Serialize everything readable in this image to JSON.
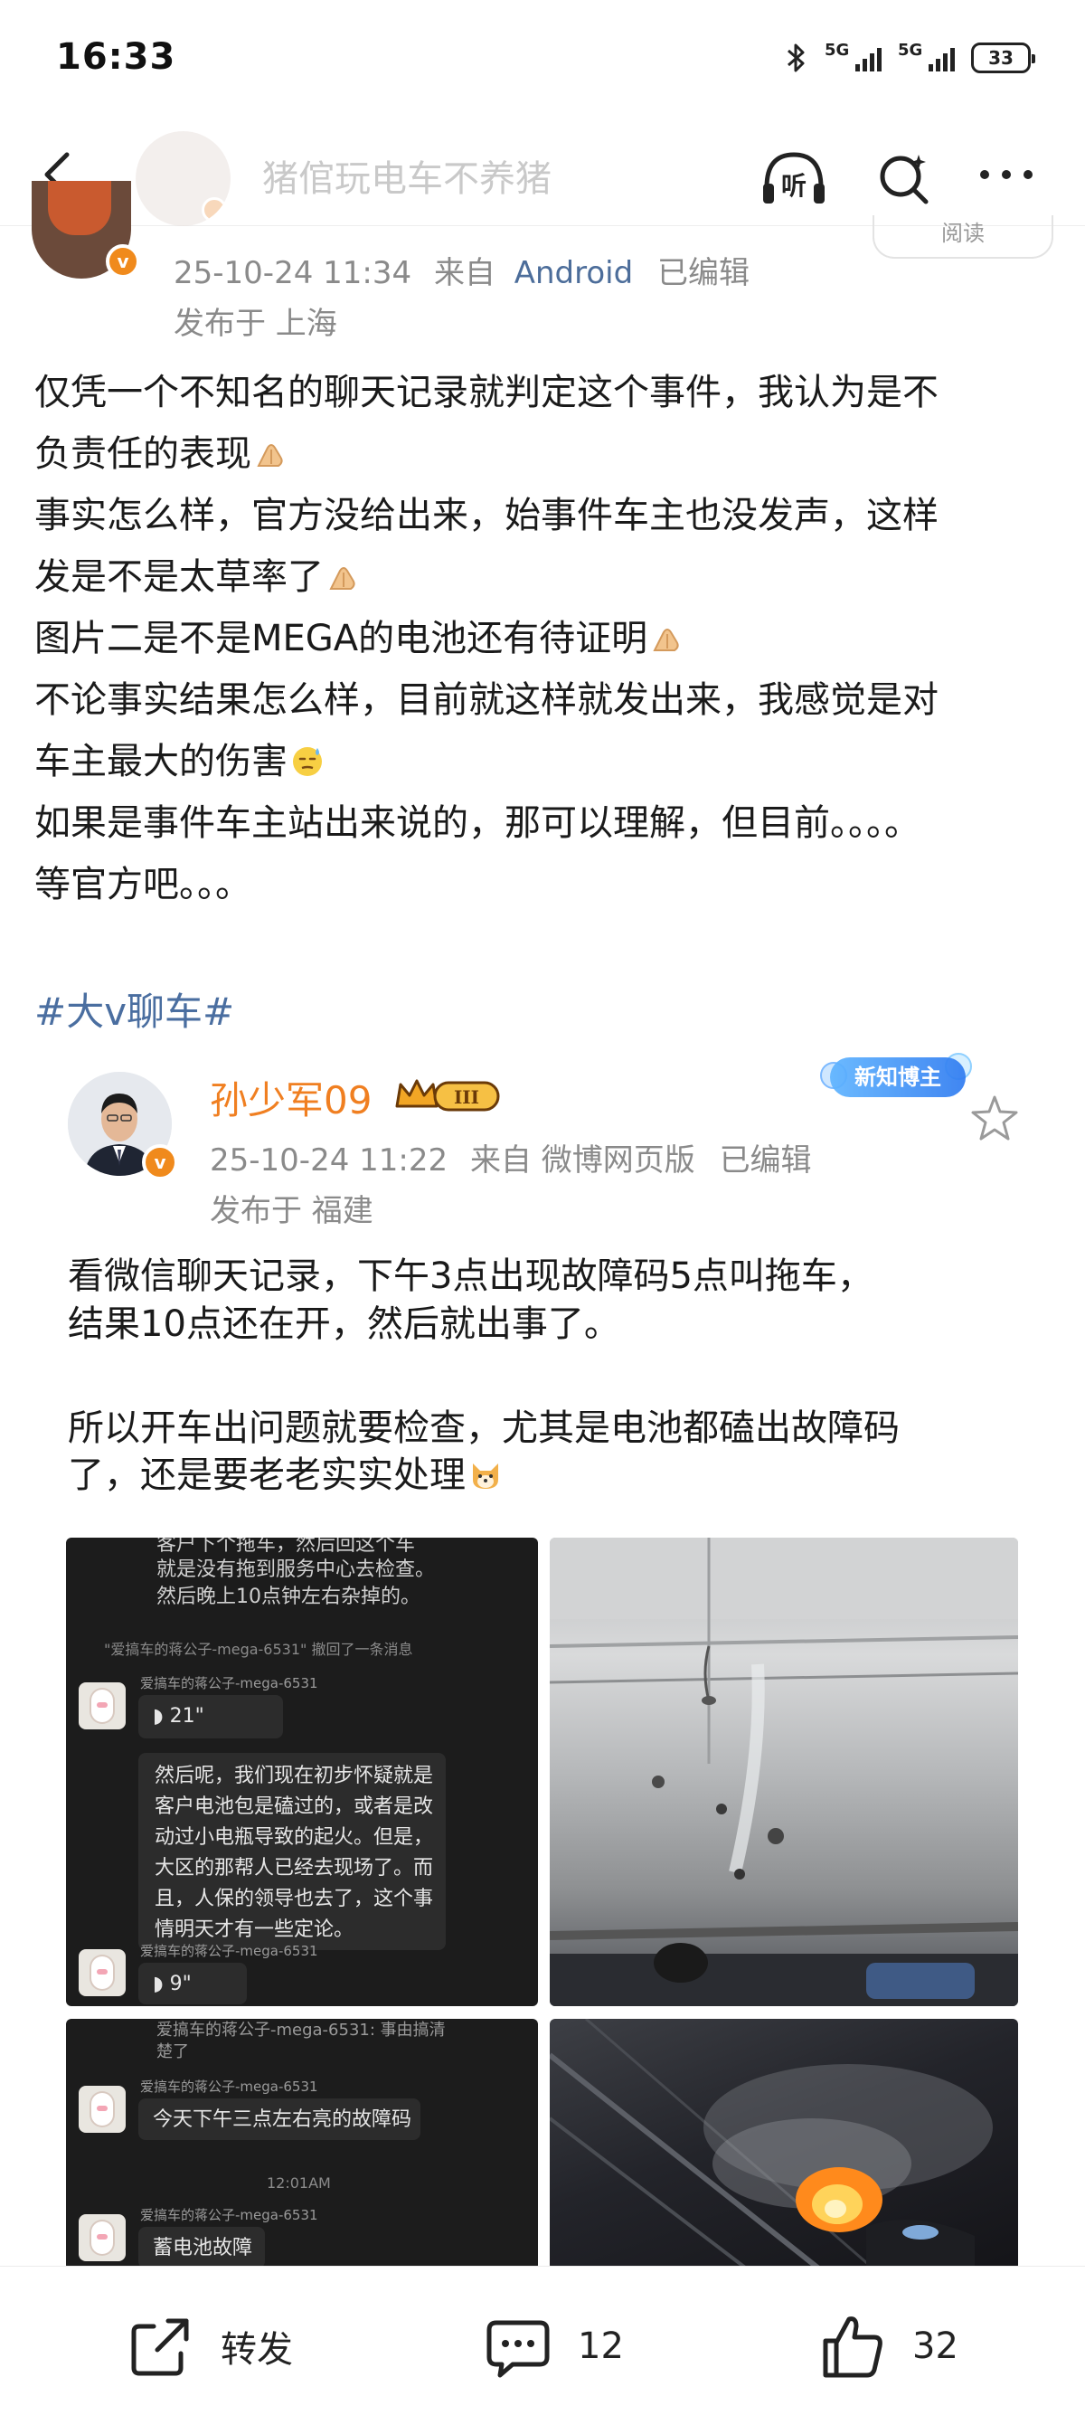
{
  "status_bar": {
    "time": "16:33",
    "signal1_label": "5G",
    "signal2_label": "5G",
    "battery": "33"
  },
  "nav": {
    "title": "猪倌玩电车不养猪",
    "icons": [
      "back-icon",
      "listen-icon",
      "search-icon",
      "more-icon"
    ],
    "listen_label": "听"
  },
  "post": {
    "read_label": "阅读",
    "timestamp": "25-10-24 11:34",
    "from_label": "来自",
    "source": "Android",
    "edited": "已编辑",
    "location": "发布于 上海",
    "lines": [
      "仅凭一个不知名的聊天记录就判定这个事件，我认为是不",
      "负责任的表现",
      "事实怎么样，官方没给出来，始事件车主也没发声，这样",
      "发是不是太草率了",
      "图片二是不是MEGA的电池还有待证明",
      "不论事实结果怎么样，目前就这样就发出来，我感觉是对",
      "车主最大的伤害",
      "如果是事件车主站出来说的，那可以理解，但目前。。。。",
      "等官方吧。。。"
    ],
    "hashtag": "#大v聊车#"
  },
  "quoted": {
    "author": "孙少军09",
    "badge_level": "III",
    "newbie_badge": "新知博主",
    "timestamp": "25-10-24 11:22",
    "source": "来自 微博网页版",
    "edited": "已编辑",
    "location": "发布于 福建",
    "lines": [
      "看微信聊天记录，下午3点出现故障码5点叫拖车，",
      "结果10点还在开，然后就出事了。",
      "",
      "所以开车出问题就要检查，尤其是电池都磕出故障码",
      "了，还是要老老实实处理"
    ],
    "chat1": {
      "top_lines": [
        "客户下个拖车，然后回这个车",
        "就是没有拖到服务中心去检查。",
        "然后晚上10点钟左右杂掉的。"
      ],
      "system": "\"爱搞车的蒋公子-mega-6531\" 撤回了一条消息",
      "sender": "爱搞车的蒋公子-mega-6531",
      "voice1": "21\"",
      "lines": [
        "然后呢，我们现在初步怀疑就是",
        "客户电池包是磕过的，或者是改",
        "动过小电瓶导致的起火。但是，",
        "大区的那帮人已经去现场了。而",
        "且，人保的领导也去了，这个事",
        "情明天才有一些定论。"
      ],
      "voice2": "9\""
    },
    "chat2": {
      "top_lines": [
        "爱搞车的蒋公子-mega-6531: 事由搞清",
        "楚了"
      ],
      "sender1": "爱搞车的蒋公子-mega-6531",
      "msg1": "今天下午三点左右亮的故障码",
      "time": "12:01AM",
      "sender2": "爱搞车的蒋公子-mega-6531",
      "msg2": "蓄电池故障"
    }
  },
  "actions": {
    "repost_label": "转发",
    "comment_count": "12",
    "like_count": "32"
  },
  "colors": {
    "accent_blue": "#4a6ea0",
    "name_orange": "#f07f21",
    "meta_gray": "#8a8a8a"
  }
}
